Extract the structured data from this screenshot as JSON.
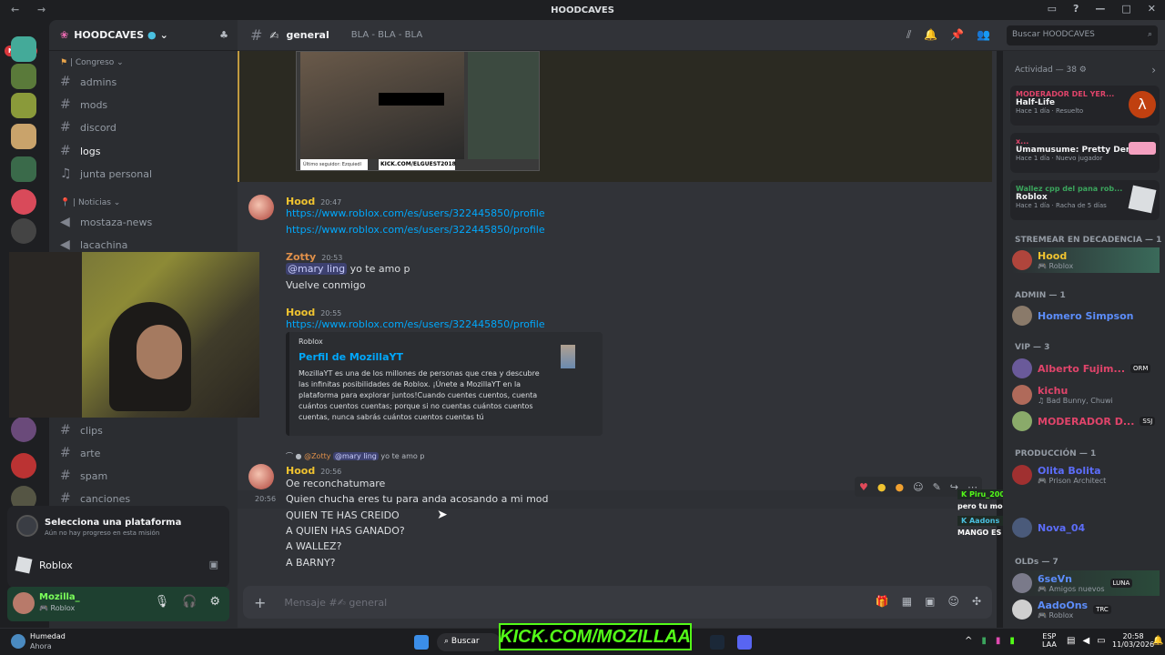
{
  "title_bar": {
    "title": "HOODCAVES"
  },
  "rail": {
    "new_badge": "NUEVO"
  },
  "server": {
    "name": "HOODCAVES"
  },
  "sidebar": {
    "categories": [
      {
        "label": "| Congreso",
        "channels": [
          "admins",
          "mods",
          "discord",
          "logs",
          "junta personal"
        ]
      },
      {
        "label": "| Noticias",
        "channels": [
          "mostaza-news",
          "lacachina"
        ]
      }
    ],
    "lower_channels": [
      "clips",
      "arte",
      "spam",
      "canciones"
    ]
  },
  "platform_panel": {
    "title": "Selecciona una plataforma",
    "subtitle": "Aún no hay progreso en esta misión",
    "game": "Roblox"
  },
  "user_panel": {
    "name": "Mozilla_",
    "status": "Roblox"
  },
  "chat": {
    "channel": "general",
    "topic": "BLA - BLA - BLA",
    "search_placeholder": "Buscar HOODCAVES",
    "image_caption_left": "Último seguidor: Ezquiedl",
    "image_caption_right": "KICK.COM/ELGUEST2018",
    "messages": [
      {
        "author": "Hood",
        "time": "20:47",
        "lines": [
          "https://www.roblox.com/es/users/322445850/profile",
          "https://www.roblox.com/es/users/322445850/profile"
        ]
      },
      {
        "author": "Zotty",
        "time": "20:53",
        "mention": "@mary ling",
        "text": "yo te amo p",
        "line2": "Vuelve conmigo"
      },
      {
        "author": "Hood",
        "time": "20:55",
        "link": "https://www.roblox.com/es/users/322445850/profile"
      },
      {
        "author": "Hood",
        "time": "20:56",
        "reply_author": "@Zotty",
        "reply_mention": "@mary ling",
        "reply_text": "yo te amo p",
        "lines": [
          "Oe reconchatumare",
          "Quien chucha eres tu para anda acosando a mi mod",
          "QUIEN TE HAS CREIDO",
          "A QUIEN HAS GANADO?",
          "A WALLEZ?",
          "A BARNY?"
        ],
        "hover_time": "20:56"
      }
    ],
    "embed": {
      "provider": "Roblox",
      "title": "Perfil de MozillaYT",
      "description": "MozillaYT es una de los millones de personas que crea y descubre las infinitas posibilidades de Roblox. ¡Únete a MozillaYT en la plataforma para explorar juntos!Cuando cuentes cuentos, cuenta cuántos cuentos cuentas; porque si no cuentas cuántos cuentos cuentas, nunca sabrás cuántos cuentos cuentas tú"
    },
    "composer_placeholder": "Mensaje #",
    "composer_channel": "general"
  },
  "overlay_chat": [
    {
      "user": "Piru_200",
      "text": "pero tu mod no esta con wallez?"
    },
    {
      "user": "Aadons",
      "text": "MANGO ES PROPIEDAD DE WALLEZ"
    }
  ],
  "members": {
    "activity_title": "Actividad — 38",
    "activities": [
      {
        "user": "MODERADOR DEL YER...",
        "game": "Half-Life",
        "time": "Hace 1 día",
        "status": "Resuelto"
      },
      {
        "user": "x...",
        "game": "Umamusume: Pretty Derby ...",
        "time": "Hace 1 día",
        "status": "Nuevo jugador"
      },
      {
        "user": "Wallez cpp del pana rob...",
        "game": "Roblox",
        "time": "Hace 1 día",
        "status": "Racha de 5 días"
      }
    ],
    "sections": [
      {
        "title": "STREMEAR EN DECADENCIA — 1",
        "items": [
          {
            "name": "Hood",
            "sub": "Roblox"
          }
        ]
      },
      {
        "title": "ADMIN — 1",
        "items": [
          {
            "name": "Homero Simpson",
            "sub": ""
          }
        ]
      },
      {
        "title": "VIP — 3",
        "items": [
          {
            "name": "Alberto Fujim...",
            "sub": "",
            "tag": "ORM"
          },
          {
            "name": "kichu",
            "sub": "Bad Bunny, Chuwi"
          },
          {
            "name": "MODERADOR D...",
            "sub": "",
            "tag": "SSJ"
          }
        ]
      },
      {
        "title": "PRODUCCIÓN — 1",
        "items": [
          {
            "name": "Olita Bolita",
            "sub": "Prison Architect"
          }
        ]
      },
      {
        "title": "",
        "items": [
          {
            "name": "Nova_04",
            "sub": ""
          }
        ]
      },
      {
        "title": "OLDs — 7",
        "items": [
          {
            "name": "6seVn",
            "sub": "Amigos nuevos",
            "tag": "LUNA"
          },
          {
            "name": "AadoOns",
            "sub": "Roblox",
            "tag": "TRC"
          }
        ]
      }
    ]
  },
  "taskbar": {
    "weather_title": "Humedad",
    "weather_sub": "Ahora",
    "search": "Buscar",
    "lang": "ESP",
    "lang_sub": "LAA",
    "time": "20:58",
    "date": "11/03/2026"
  },
  "stream_overlay": {
    "kick": "KICK.COM/MOZILLAA"
  }
}
